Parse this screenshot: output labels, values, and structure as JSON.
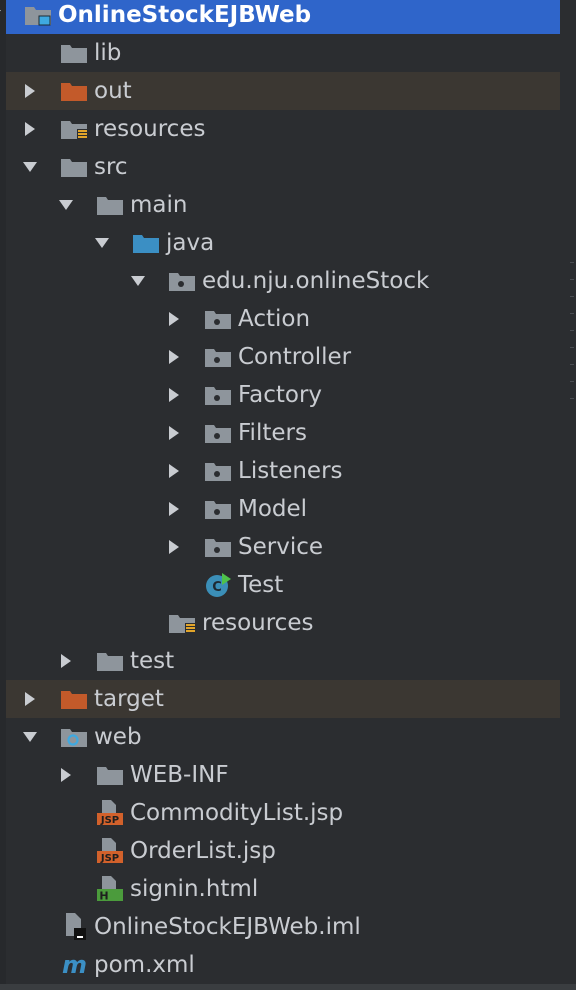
{
  "colors": {
    "background": "#2b2d30",
    "selection": "#2f65ca",
    "excluded_row": "#3b3732",
    "folder_gray": "#8e959c",
    "folder_blue": "#3b8fc4",
    "folder_orange": "#c35a2a",
    "text": "#c9ccd1"
  },
  "tree": [
    {
      "label": "OnlineStockEJBWeb",
      "depth": 0,
      "arrow": "expanded",
      "icon": "module-folder-icon",
      "selected": true
    },
    {
      "label": "lib",
      "depth": 1,
      "arrow": "none",
      "icon": "folder-icon"
    },
    {
      "label": "out",
      "depth": 1,
      "arrow": "collapsed",
      "icon": "excluded-folder-icon",
      "excluded": true
    },
    {
      "label": "resources",
      "depth": 1,
      "arrow": "collapsed",
      "icon": "resources-folder-icon"
    },
    {
      "label": "src",
      "depth": 1,
      "arrow": "expanded",
      "icon": "folder-icon"
    },
    {
      "label": "main",
      "depth": 2,
      "arrow": "expanded",
      "icon": "folder-icon"
    },
    {
      "label": "java",
      "depth": 3,
      "arrow": "expanded",
      "icon": "source-root-folder-icon"
    },
    {
      "label": "edu.nju.onlineStock",
      "depth": 4,
      "arrow": "expanded",
      "icon": "package-icon"
    },
    {
      "label": "Action",
      "depth": 5,
      "arrow": "collapsed",
      "icon": "package-icon"
    },
    {
      "label": "Controller",
      "depth": 5,
      "arrow": "collapsed",
      "icon": "package-icon"
    },
    {
      "label": "Factory",
      "depth": 5,
      "arrow": "collapsed",
      "icon": "package-icon"
    },
    {
      "label": "Filters",
      "depth": 5,
      "arrow": "collapsed",
      "icon": "package-icon"
    },
    {
      "label": "Listeners",
      "depth": 5,
      "arrow": "collapsed",
      "icon": "package-icon"
    },
    {
      "label": "Model",
      "depth": 5,
      "arrow": "collapsed",
      "icon": "package-icon"
    },
    {
      "label": "Service",
      "depth": 5,
      "arrow": "collapsed",
      "icon": "package-icon"
    },
    {
      "label": "Test",
      "depth": 5,
      "arrow": "none",
      "icon": "java-class-run-icon"
    },
    {
      "label": "resources",
      "depth": 4,
      "arrow": "none",
      "icon": "resources-folder-icon"
    },
    {
      "label": "test",
      "depth": 2,
      "arrow": "collapsed",
      "icon": "folder-icon"
    },
    {
      "label": "target",
      "depth": 1,
      "arrow": "collapsed",
      "icon": "excluded-folder-icon",
      "excluded": true
    },
    {
      "label": "web",
      "depth": 1,
      "arrow": "expanded",
      "icon": "web-folder-icon"
    },
    {
      "label": "WEB-INF",
      "depth": 2,
      "arrow": "collapsed",
      "icon": "folder-icon"
    },
    {
      "label": "CommodityList.jsp",
      "depth": 2,
      "arrow": "none",
      "icon": "jsp-file-icon"
    },
    {
      "label": "OrderList.jsp",
      "depth": 2,
      "arrow": "none",
      "icon": "jsp-file-icon"
    },
    {
      "label": "signin.html",
      "depth": 2,
      "arrow": "none",
      "icon": "html-file-icon"
    },
    {
      "label": "OnlineStockEJBWeb.iml",
      "depth": 1,
      "arrow": "none",
      "icon": "iml-file-icon"
    },
    {
      "label": "pom.xml",
      "depth": 1,
      "arrow": "none",
      "icon": "maven-file-icon"
    }
  ]
}
